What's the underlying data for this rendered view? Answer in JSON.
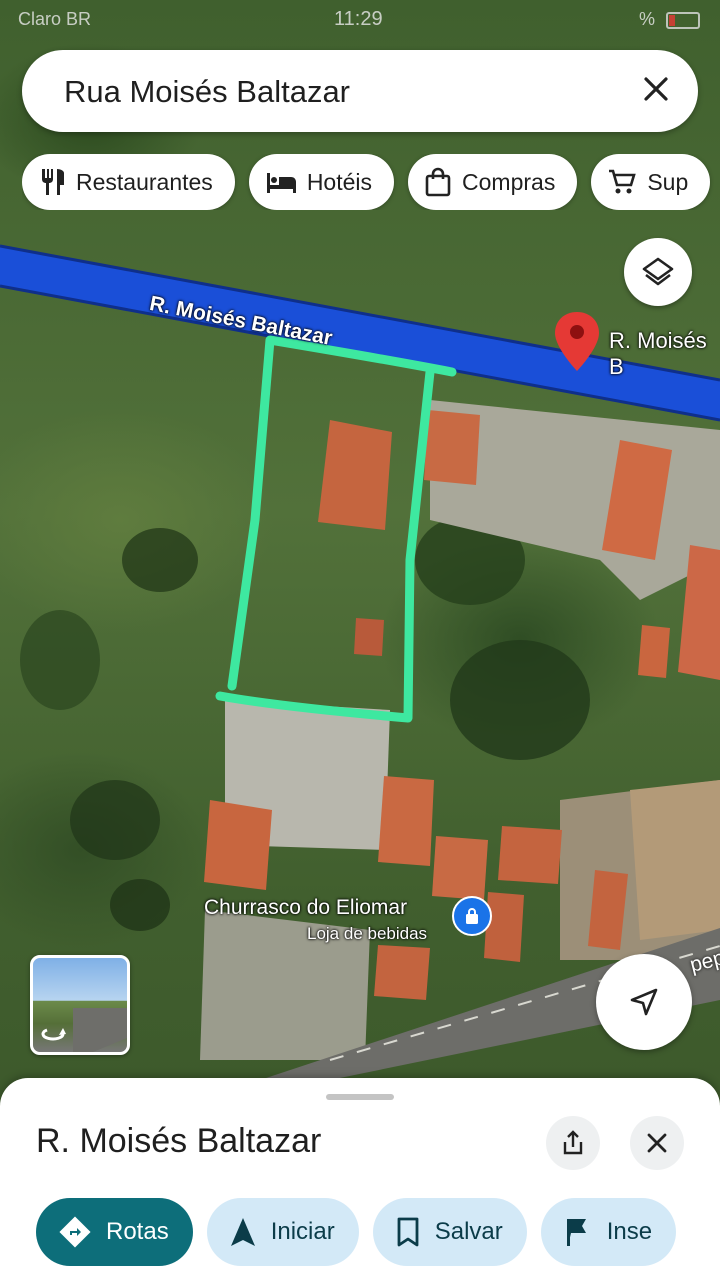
{
  "status_bar": {
    "carrier": "Claro BR",
    "time": "11:29",
    "battery": "%"
  },
  "search": {
    "query": "Rua Moisés Baltazar"
  },
  "chips": [
    {
      "label": "Restaurantes",
      "icon": "restaurant-icon"
    },
    {
      "label": "Hotéis",
      "icon": "hotel-icon"
    },
    {
      "label": "Compras",
      "icon": "shopping-bag-icon"
    },
    {
      "label": "Sup",
      "icon": "cart-icon"
    }
  ],
  "map": {
    "road_label": "R. Moisés Baltazar",
    "pin_label": "R. Moisés B",
    "place_name": "Churrasco do Eliomar",
    "place_category": "Loja de bebidas",
    "other_road_label": "pep",
    "colors": {
      "road": "#1a4fd8",
      "highlight": "#3ee8a0",
      "pin": "#e53935"
    }
  },
  "sheet": {
    "title": "R. Moisés Baltazar",
    "actions": [
      {
        "label": "Rotas",
        "icon": "directions-icon"
      },
      {
        "label": "Iniciar",
        "icon": "navigation-arrow-icon"
      },
      {
        "label": "Salvar",
        "icon": "bookmark-icon"
      },
      {
        "label": "Inse",
        "icon": "flag-icon"
      }
    ]
  }
}
